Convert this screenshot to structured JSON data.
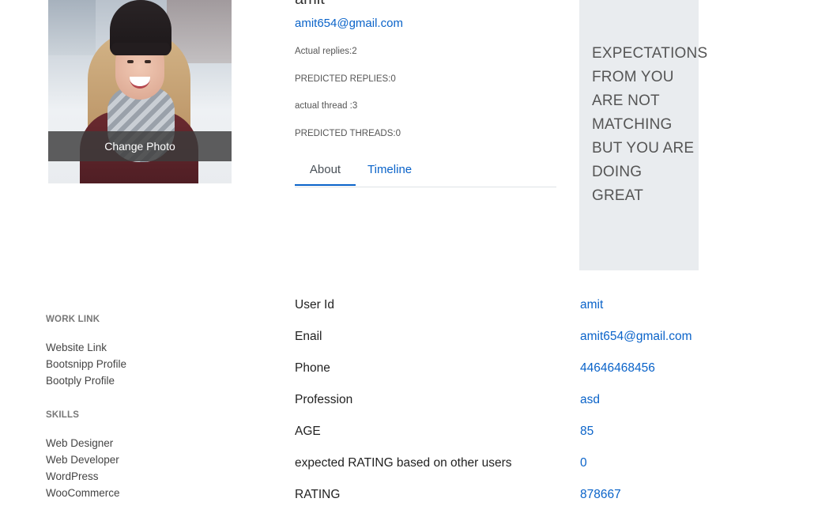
{
  "profile": {
    "change_photo_label": "Change Photo",
    "name": "amit",
    "email": "amit654@gmail.com",
    "stats": {
      "actual_replies": "Actual replies:2",
      "predicted_replies": "PREDICTED REPLIES:0",
      "actual_thread": "actual thread :3",
      "predicted_threads": "PREDICTED THREADS:0"
    }
  },
  "tabs": {
    "about": "About",
    "timeline": "Timeline"
  },
  "expectations": {
    "lines": [
      "EXPECTATIONS",
      "FROM YOU",
      "ARE NOT",
      "MATCHING",
      "BUT YOU ARE",
      "DOING",
      "GREAT"
    ]
  },
  "sidebar": {
    "work_link_heading": "WORK LINK",
    "work_links": [
      "Website Link",
      "Bootsnipp Profile",
      "Bootply Profile"
    ],
    "skills_heading": "SKILLS",
    "skills": [
      "Web Designer",
      "Web Developer",
      "WordPress",
      "WooCommerce"
    ]
  },
  "details": [
    {
      "label": "User Id",
      "value": "amit"
    },
    {
      "label": "Enail",
      "value": "amit654@gmail.com"
    },
    {
      "label": "Phone",
      "value": "44646468456"
    },
    {
      "label": "Profession",
      "value": "asd"
    },
    {
      "label": "AGE",
      "value": "85"
    },
    {
      "label": "expected RATING based on other users",
      "value": "0"
    },
    {
      "label": "RATING",
      "value": "878667"
    }
  ],
  "colors": {
    "accent": "#0a63c9",
    "box_bg": "#e9ecef"
  }
}
